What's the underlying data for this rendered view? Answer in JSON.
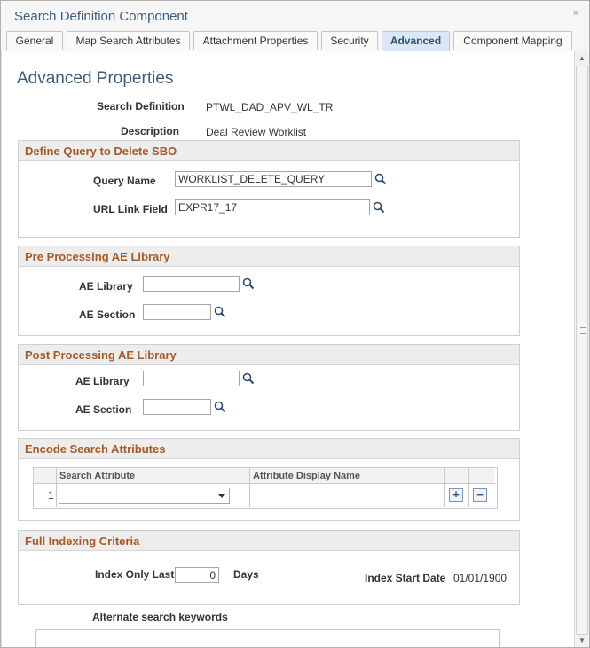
{
  "window": {
    "title": "Search Definition Component",
    "close_label": "×"
  },
  "tabs": [
    {
      "label": "General"
    },
    {
      "label": "Map Search Attributes"
    },
    {
      "label": "Attachment Properties"
    },
    {
      "label": "Security"
    },
    {
      "label": "Advanced"
    },
    {
      "label": "Component Mapping"
    }
  ],
  "active_tab": "Advanced",
  "page": {
    "heading": "Advanced Properties"
  },
  "summary": {
    "search_definition_label": "Search Definition",
    "search_definition_value": "PTWL_DAD_APV_WL_TR",
    "description_label": "Description",
    "description_value": "Deal Review Worklist"
  },
  "delete_sbo": {
    "title": "Define Query to Delete SBO",
    "query_name_label": "Query Name",
    "query_name_value": "WORKLIST_DELETE_QUERY",
    "url_link_field_label": "URL Link Field",
    "url_link_field_value": "EXPR17_17"
  },
  "pre_processing": {
    "title": "Pre Processing AE Library",
    "ae_library_label": "AE Library",
    "ae_library_value": "",
    "ae_section_label": "AE Section",
    "ae_section_value": ""
  },
  "post_processing": {
    "title": "Post Processing AE Library",
    "ae_library_label": "AE Library",
    "ae_library_value": "",
    "ae_section_label": "AE Section",
    "ae_section_value": ""
  },
  "encode": {
    "title": "Encode Search Attributes",
    "columns": [
      "Search Attribute",
      "Attribute Display Name"
    ],
    "rows": [
      {
        "num": "1",
        "search_attribute": "",
        "display_name": ""
      }
    ],
    "add_label": "+",
    "delete_label": "−"
  },
  "full_indexing": {
    "title": "Full Indexing Criteria",
    "index_only_last_label": "Index Only Last",
    "index_only_last_value": "0",
    "days_label": "Days",
    "index_start_date_label": "Index Start Date",
    "index_start_date_value": "01/01/1900"
  },
  "alternate_keywords": {
    "label": "Alternate search keywords",
    "value": ""
  },
  "colors": {
    "heading": "#3a5c80",
    "group_title": "#a55a25",
    "active_tab_bg": "#dbe7f4"
  }
}
